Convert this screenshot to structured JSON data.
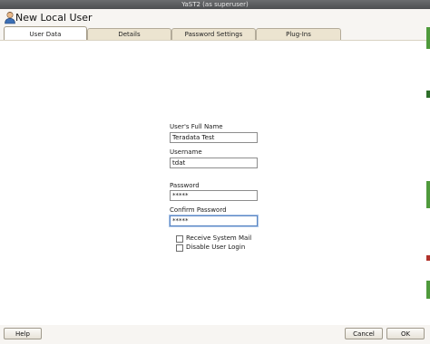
{
  "window": {
    "title": "YaST2 (as superuser)"
  },
  "header": {
    "title": "New Local User",
    "icon": "user-icon"
  },
  "tabs": [
    {
      "label": "User Data",
      "active": true
    },
    {
      "label": "Details",
      "active": false
    },
    {
      "label": "Password Settings",
      "active": false
    },
    {
      "label": "Plug-Ins",
      "active": false
    }
  ],
  "form": {
    "full_name": {
      "label": "User's Full Name",
      "value": "Teradata Test"
    },
    "username": {
      "label": "Username",
      "value": "tdat"
    },
    "password": {
      "label": "Password",
      "value": "*****"
    },
    "confirm_password": {
      "label": "Confirm Password",
      "value": "*****"
    },
    "receive_mail": {
      "label": "Receive System Mail",
      "checked": false
    },
    "disable_login": {
      "label": "Disable User Login",
      "checked": false
    }
  },
  "buttons": {
    "help": "Help",
    "cancel": "Cancel",
    "ok": "OK"
  },
  "colors": {
    "tab_active": "#ffffff",
    "tab_inactive": "#ece4d0",
    "focus": "#5a86c4",
    "side_edge_green": "#4f9a3c"
  }
}
